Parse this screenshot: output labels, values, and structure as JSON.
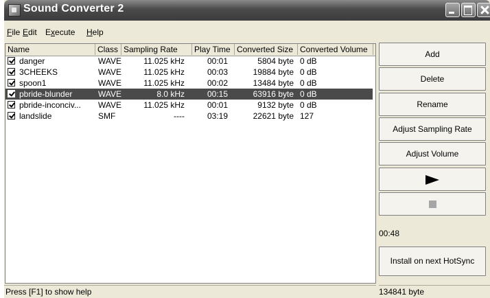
{
  "window": {
    "title": "Sound Converter 2"
  },
  "menu": [
    {
      "prefix": "",
      "accel": "F",
      "rest": "ile"
    },
    {
      "prefix": "",
      "accel": "E",
      "rest": "dit"
    },
    {
      "prefix": "E",
      "accel": "x",
      "rest": "ecute"
    },
    {
      "prefix": "",
      "accel": "H",
      "rest": "elp"
    }
  ],
  "table": {
    "columns": [
      "Name",
      "Class",
      "Sampling Rate",
      "Play Time",
      "Converted Size",
      "Converted Volume"
    ],
    "rows": [
      {
        "checked": true,
        "name": "danger",
        "class": "WAVE",
        "rate": "11.025 kHz",
        "time": "00:01",
        "size": "5804 byte",
        "volume": "0 dB",
        "selected": false
      },
      {
        "checked": true,
        "name": "3CHEEKS",
        "class": "WAVE",
        "rate": "11.025 kHz",
        "time": "00:03",
        "size": "19884 byte",
        "volume": "0 dB",
        "selected": false
      },
      {
        "checked": true,
        "name": "spoon1",
        "class": "WAVE",
        "rate": "11.025 kHz",
        "time": "00:02",
        "size": "13484 byte",
        "volume": "0 dB",
        "selected": false
      },
      {
        "checked": true,
        "name": "pbride-blunder",
        "class": "WAVE",
        "rate": "8.0 kHz",
        "time": "00:15",
        "size": "63916 byte",
        "volume": "0 dB",
        "selected": true
      },
      {
        "checked": true,
        "name": "pbride-inconciv...",
        "class": "WAVE",
        "rate": "11.025 kHz",
        "time": "00:01",
        "size": "9132 byte",
        "volume": "0 dB",
        "selected": false
      },
      {
        "checked": true,
        "name": "landslide",
        "class": "SMF",
        "rate": "----",
        "time": "03:19",
        "size": "22621 byte",
        "volume": "127",
        "selected": false
      }
    ]
  },
  "buttons": {
    "add": "Add",
    "delete": "Delete",
    "rename": "Rename",
    "adjust_rate": "Adjust Sampling Rate",
    "adjust_volume": "Adjust Volume",
    "play_icon": "play-icon",
    "stop_icon": "stop-icon",
    "install": "Install on next HotSync"
  },
  "total_time": "00:48",
  "status": {
    "help": "Press [F1] to show help",
    "total_size": "134841 byte"
  },
  "colors": {
    "selected_row": "#4a4a4a",
    "title_bar": "#4a4a4a"
  }
}
